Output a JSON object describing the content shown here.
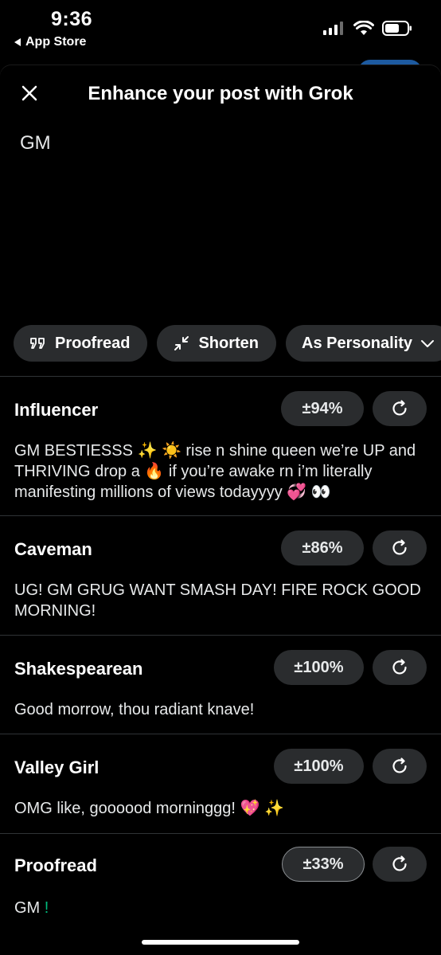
{
  "status_bar": {
    "time": "9:36",
    "back_label": "App Store"
  },
  "sheet": {
    "title": "Enhance your post with Grok",
    "post_text": "GM"
  },
  "chips": [
    {
      "label": "Proofread",
      "icon": "quote-icon"
    },
    {
      "label": "Shorten",
      "icon": "shrink-arrows-icon"
    },
    {
      "label": "As Personality",
      "icon": "chevron-down-icon"
    }
  ],
  "results": [
    {
      "name": "Influencer",
      "percent": "±94%",
      "text": "GM BESTIESSS ✨ ☀️ rise n shine queen we’re UP and THRIVING drop a 🔥 if you’re awake rn i’m literally manifesting millions of views todayyyy 💞 👀"
    },
    {
      "name": "Caveman",
      "percent": "±86%",
      "text": "UG! GM GRUG WANT SMASH DAY! FIRE ROCK GOOD MORNING!"
    },
    {
      "name": "Shakespearean",
      "percent": "±100%",
      "text": "Good morrow, thou radiant knave!"
    },
    {
      "name": "Valley Girl",
      "percent": "±100%",
      "text": "OMG like, goooood morninggg! 💖 ✨"
    },
    {
      "name": "Proofread",
      "percent": "±33%",
      "text_main": "GM",
      "text_added": "!"
    }
  ],
  "colors": {
    "background": "#000000",
    "chip_bg": "#2a2c2e",
    "divider": "#2f3336",
    "added_text": "#00ba7c"
  }
}
